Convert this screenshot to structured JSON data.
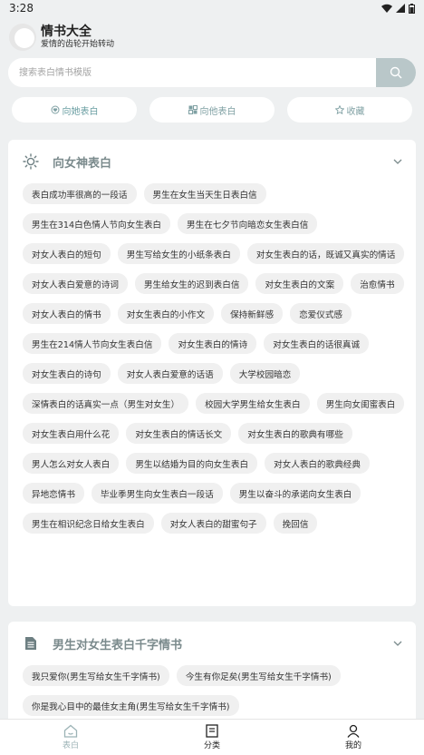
{
  "status": {
    "time": "3:28",
    "icons": [
      "wifi-icon",
      "signal-icon",
      "battery-icon"
    ]
  },
  "header": {
    "title": "情书大全",
    "subtitle": "爱情的齿轮开始转动"
  },
  "search": {
    "placeholder": "搜索表白情书模版",
    "icon": "search-icon"
  },
  "tabs": [
    {
      "label": "向她表白",
      "icon": "heart-icon",
      "active": true
    },
    {
      "label": "向他表白",
      "icon": "grid-icon",
      "active": false
    },
    {
      "label": "收藏",
      "icon": "star-icon",
      "active": false
    }
  ],
  "sections": [
    {
      "title": "向女神表白",
      "icon": "sun-icon",
      "items": [
        "表白成功率很高的一段话",
        "男生在女生当天生日表白信",
        "男生在314白色情人节向女生表白",
        "男生在七夕节向暗恋女生表白信",
        "对女人表白的短句",
        "男生写给女生的小纸条表白",
        "对女生表白的话，既诚又真实的情话",
        "对女人表白爱意的诗词",
        "男生给女生的迟到表白信",
        "对女生表白的文案",
        "治愈情书",
        "对女人表白的情书",
        "对女生表白的小作文",
        "保持新鲜感",
        "恋爱仪式感",
        "男生在214情人节向女生表白信",
        "对女生表白的情诗",
        "对女生表白的话很真诚",
        "对女生表白的诗句",
        "对女人表白爱意的话语",
        "大学校园暗恋",
        "深情表白的话真实一点（男生对女生）",
        "校园大学男生给女生表白",
        "男生向女闺蜜表白",
        "对女生表白用什么花",
        "对女生表白的情话长文",
        "对女生表白的歌典有哪些",
        "男人怎么对女人表白",
        "男生以结婚为目的向女生表白",
        "对女人表白的歌典经典",
        "异地恋情书",
        "毕业季男生向女生表白一段话",
        "男生以奋斗的承诺向女生表白",
        "男生在相识纪念日给女生表白",
        "对女人表白的甜蜜句子",
        "挽回信"
      ]
    },
    {
      "title": "男生对女生表白千字情书",
      "icon": "document-icon",
      "items": [
        "我只爱你(男生写给女生千字情书)",
        "今生有你足矣(男生写给女生千字情书)",
        "你是我心目中的最佳女主角(男生写给女生千字情书)"
      ]
    }
  ],
  "bottom_nav": [
    {
      "label": "表白",
      "icon": "home-icon",
      "active": true
    },
    {
      "label": "分类",
      "icon": "list-icon",
      "active": false
    },
    {
      "label": "我的",
      "icon": "person-icon",
      "active": false
    }
  ],
  "colors": {
    "accent": "#6a9ea2",
    "search_button": "#b9c7c9",
    "background": "#eef0f1"
  }
}
